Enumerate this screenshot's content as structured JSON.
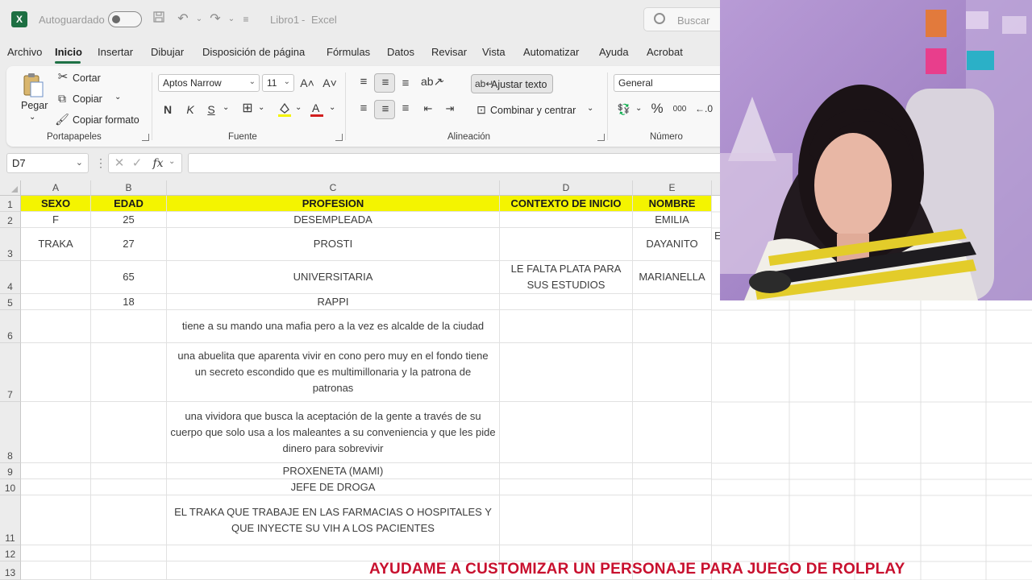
{
  "titlebar": {
    "logo": "X",
    "autosave_label": "Autoguardado",
    "doc_title": "Libro1",
    "separator": "-",
    "app_name": "Excel",
    "search_label": "Buscar"
  },
  "menu": [
    "Archivo",
    "Inicio",
    "Insertar",
    "Dibujar",
    "Disposición de página",
    "Fórmulas",
    "Datos",
    "Revisar",
    "Vista",
    "Automatizar",
    "Ayuda",
    "Acrobat"
  ],
  "ribbon": {
    "clipboard": {
      "paste": "Pegar",
      "cut": "Cortar",
      "copy": "Copiar",
      "format_painter": "Copiar formato",
      "group": "Portapapeles"
    },
    "font": {
      "name": "Aptos Narrow",
      "size": "11",
      "bold": "N",
      "italic": "K",
      "underline": "S",
      "group": "Fuente"
    },
    "alignment": {
      "wrap": "Ajustar texto",
      "merge": "Combinar y centrar",
      "group": "Alineación"
    },
    "number": {
      "format": "General",
      "percent": "%",
      "thousands": "000",
      "group": "Número"
    }
  },
  "formula_bar": {
    "cell_ref": "D7",
    "fx": "fx",
    "content": ""
  },
  "grid": {
    "columns": [
      "A",
      "B",
      "C",
      "D",
      "E"
    ],
    "rows": [
      "1",
      "2",
      "3",
      "4",
      "5",
      "6",
      "7",
      "8",
      "9",
      "10",
      "11",
      "12",
      "13"
    ],
    "header": [
      "SEXO",
      "EDAD",
      "PROFESION",
      "CONTEXTO DE INICIO",
      "NOMBRE"
    ],
    "data": [
      [
        "F",
        "25",
        "DESEMPLEADA",
        "",
        "EMILIA"
      ],
      [
        "TRAKA",
        "27",
        "PROSTI",
        "",
        "DAYANITO"
      ],
      [
        "",
        "65",
        "UNIVERSITARIA",
        "LE FALTA PLATA PARA SUS ESTUDIOS",
        "MARIANELLA"
      ],
      [
        "",
        "18",
        "RAPPI",
        "",
        ""
      ],
      [
        "",
        "",
        "tiene a su mando una mafia pero a la vez es alcalde de la ciudad",
        "",
        ""
      ],
      [
        "",
        "",
        "una abuelita que aparenta vivir en cono pero muy en el fondo tiene un secreto escondido que es multimillonaria y la patrona de patronas",
        "",
        ""
      ],
      [
        "",
        "",
        "una vividora que busca la aceptación de la gente a través de su cuerpo que solo usa a los maleantes a su conveniencia y que les pide dinero para sobrevivir",
        "",
        ""
      ],
      [
        "",
        "",
        "PROXENETA (MAMI)",
        "",
        ""
      ],
      [
        "",
        "",
        "JEFE DE DROGA",
        "",
        ""
      ],
      [
        "",
        "",
        "EL TRAKA QUE TRABAJE EN LAS FARMACIAS O HOSPITALES Y QUE INYECTE SU VIH A LOS PACIENTES",
        "",
        ""
      ]
    ],
    "clipped_text": "E"
  },
  "caption": "AYUDAME A CUSTOMIZAR UN PERSONAJE PARA JUEGO DE ROLPLAY",
  "colors": {
    "header_fill": "#f4f400",
    "accent": "#1e7145",
    "caption": "#c8102e"
  }
}
